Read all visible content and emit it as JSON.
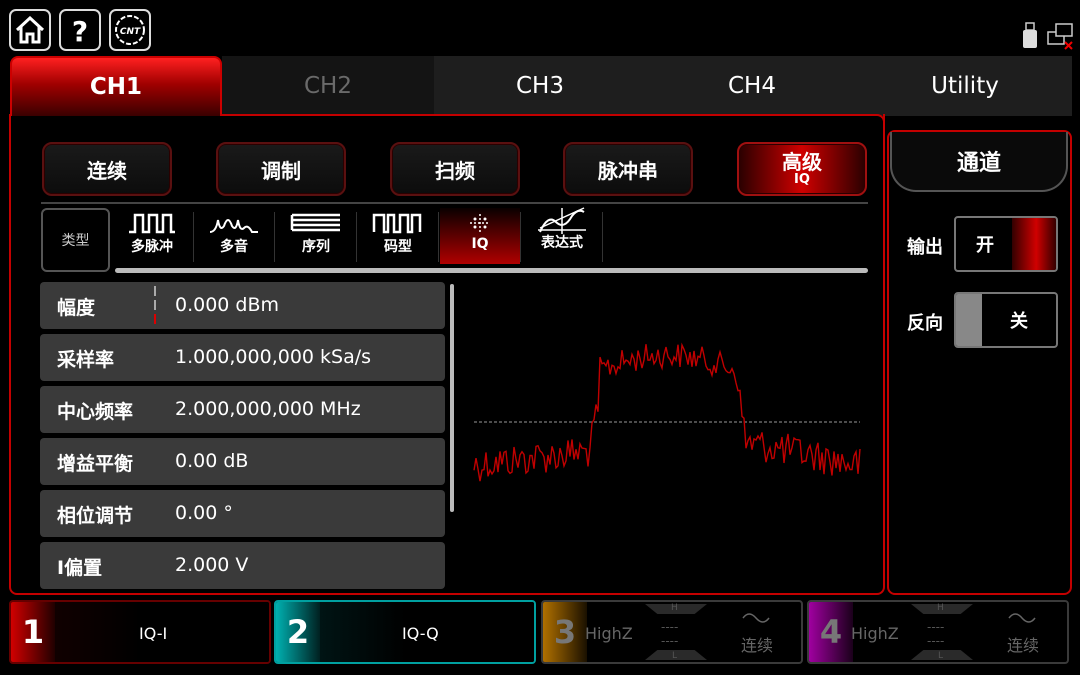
{
  "topbar": {
    "icons": [
      "home-icon",
      "help-icon",
      "cnt-logo-icon"
    ],
    "status_icons": [
      "usb-icon",
      "network-icon"
    ]
  },
  "tabs": [
    "CH1",
    "CH2",
    "CH3",
    "CH4",
    "Utility"
  ],
  "modes": [
    {
      "label": "连续"
    },
    {
      "label": "调制"
    },
    {
      "label": "扫频"
    },
    {
      "label": "脉冲串"
    },
    {
      "label": "高级",
      "sub": "IQ"
    }
  ],
  "type_label": "类型",
  "waveforms": [
    "多脉冲",
    "多音",
    "序列",
    "码型",
    "IQ",
    "表达式"
  ],
  "params": [
    {
      "label": "幅度",
      "value": "0.000 dBm"
    },
    {
      "label": "采样率",
      "value": "1.000,000,000 kSa/s"
    },
    {
      "label": "中心频率",
      "value": "2.000,000,000 MHz"
    },
    {
      "label": "增益平衡",
      "value": "0.00 dB"
    },
    {
      "label": "相位调节",
      "value": "0.00 °"
    },
    {
      "label": "I偏置",
      "value": "2.000 V"
    }
  ],
  "right_panel": {
    "title": "通道",
    "output_label": "输出",
    "output_value": "开",
    "invert_label": "反向",
    "invert_value": "关"
  },
  "channels": [
    {
      "num": "1",
      "label": "IQ-I",
      "color": "#d00000"
    },
    {
      "num": "2",
      "label": "IQ-Q",
      "color": "#00b0b0"
    },
    {
      "num": "3",
      "label": "HighZ",
      "h": "H",
      "l": "L",
      "dash1": "----",
      "dash2": "----",
      "mode": "连续",
      "color": "#c08000"
    },
    {
      "num": "4",
      "label": "HighZ",
      "h": "H",
      "l": "L",
      "dash1": "----",
      "dash2": "----",
      "mode": "连续",
      "color": "#a000a0"
    }
  ],
  "colors": {
    "accent": "#d00000",
    "trace": "#c00000"
  }
}
